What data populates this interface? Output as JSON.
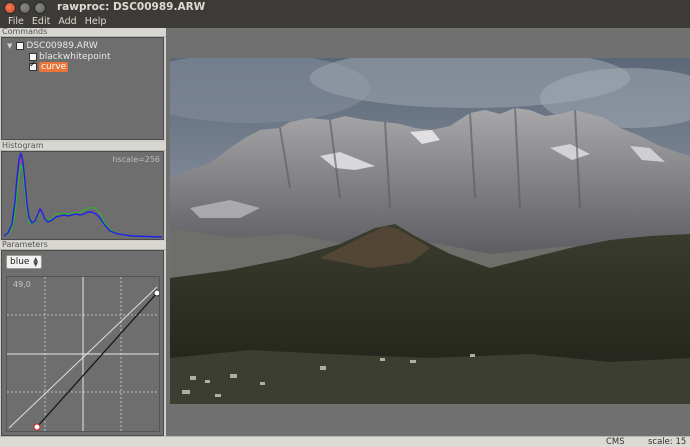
{
  "window": {
    "title": "rawproc: DSC00989.ARW"
  },
  "menu": {
    "items": [
      "File",
      "Edit",
      "Add",
      "Help"
    ]
  },
  "panels": {
    "commands": {
      "header": "Commands",
      "tree": {
        "root": {
          "label": "DSC00989.ARW",
          "checked": false
        },
        "children": [
          {
            "label": "blackwhitepoint",
            "checked": false,
            "selected": false
          },
          {
            "label": "curve",
            "checked": true,
            "selected": true
          }
        ]
      }
    },
    "histogram": {
      "header": "Histogram",
      "scale_label": "hscale=256"
    },
    "parameters": {
      "header": "Parameters",
      "channel": "blue",
      "coordinate": "49,0",
      "curve_points": [
        [
          0,
          0
        ],
        [
          255,
          235
        ]
      ]
    }
  },
  "status": {
    "cms": "CMS",
    "scale": "scale: 15"
  },
  "colors": {
    "selection": "#e9753b",
    "panel_bg": "#6e6e6e",
    "hist_blue": "#2020e8",
    "hist_green": "#20c020",
    "hist_purple": "#8040c0",
    "sky": "#6b7a8c"
  }
}
